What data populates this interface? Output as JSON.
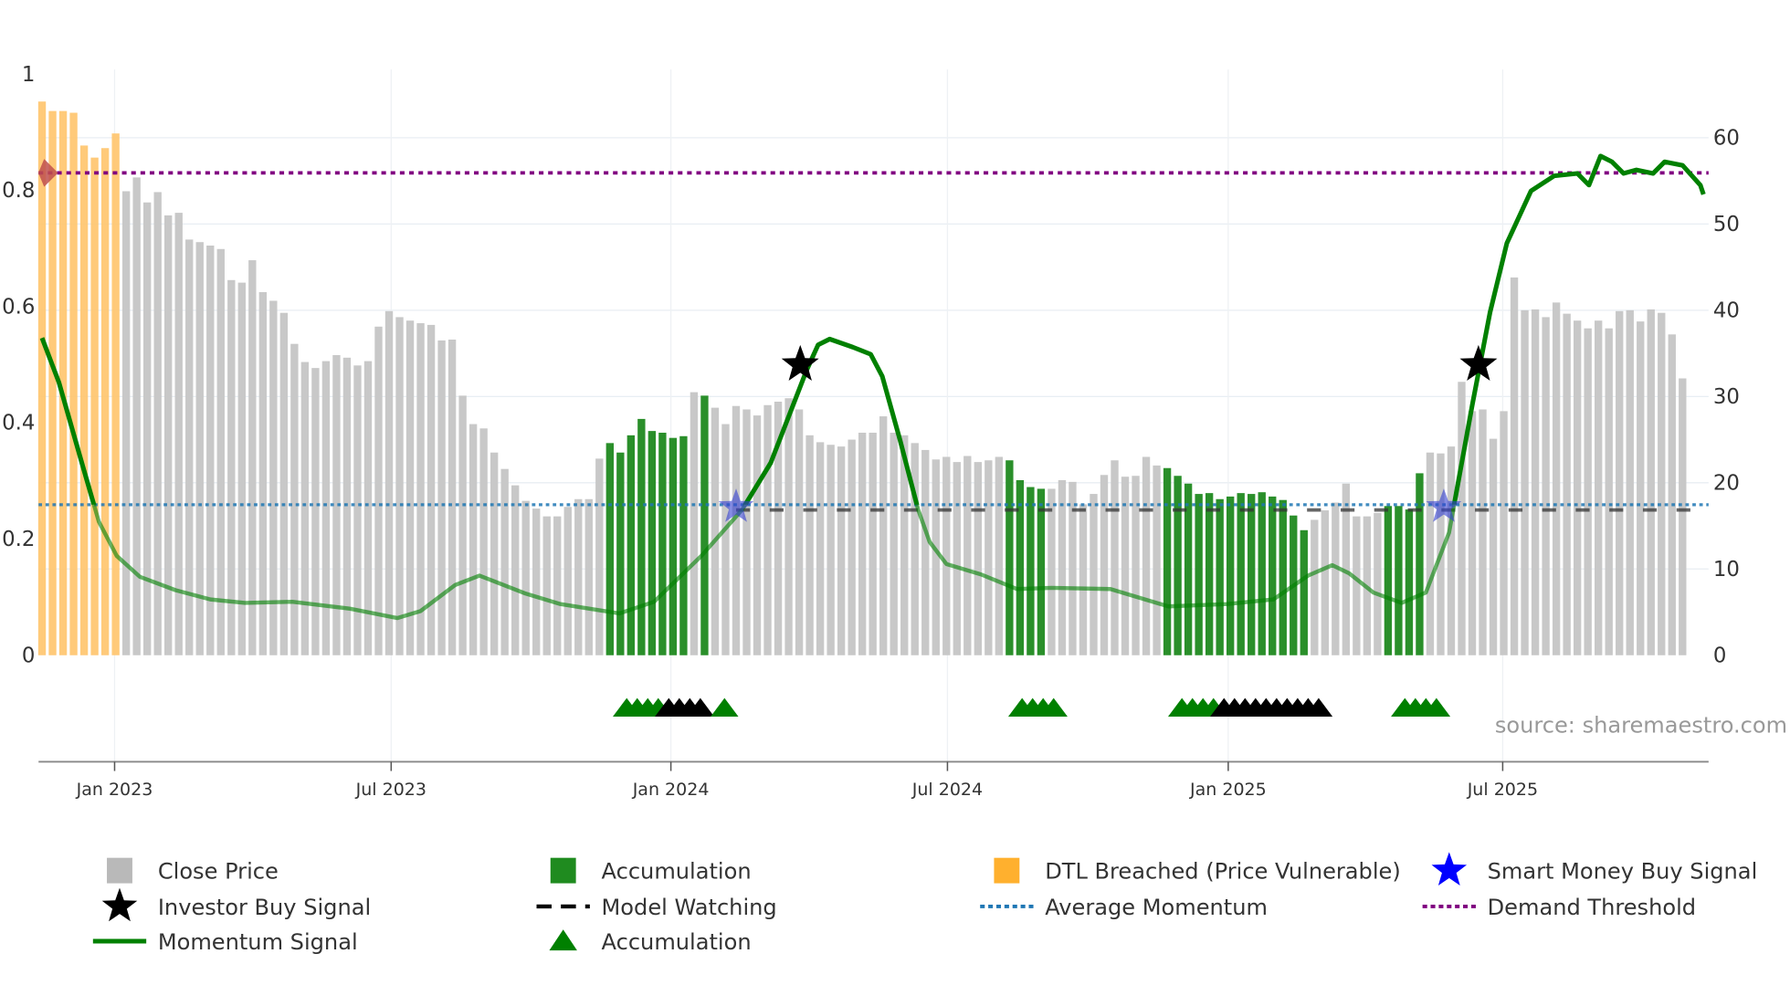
{
  "chart_data": {
    "type": "bar",
    "title": "",
    "source": "source: sharemaestro.com",
    "left_axis": {
      "ylim": [
        0,
        1
      ],
      "ticks": [
        "0",
        "0.2",
        "0.4",
        "0.6",
        "0.8",
        "1"
      ],
      "values": [
        0,
        0.2,
        0.4,
        0.6,
        0.8,
        1
      ]
    },
    "right_axis": {
      "ylim": [
        0,
        60
      ],
      "ticks": [
        "0",
        "10",
        "20",
        "30",
        "40",
        "50",
        "60"
      ],
      "values": [
        0,
        10,
        20,
        30,
        40,
        50,
        60
      ]
    },
    "x_ticks": [
      {
        "label": "Jan 2023",
        "week": 6.9
      },
      {
        "label": "Jul 2023",
        "week": 33.2
      },
      {
        "label": "Jan 2024",
        "week": 59.8
      },
      {
        "label": "Jul 2024",
        "week": 86.1
      },
      {
        "label": "Jan 2025",
        "week": 112.8
      },
      {
        "label": "Jul 2025",
        "week": 138.9
      }
    ],
    "close_price": [
      64.2,
      63.1,
      63.1,
      62.9,
      59.1,
      57.7,
      58.8,
      60.5,
      53.8,
      55.4,
      52.5,
      53.7,
      51.0,
      51.3,
      48.2,
      47.9,
      47.5,
      47.1,
      43.5,
      43.2,
      45.8,
      42.1,
      41.1,
      39.7,
      36.1,
      34.0,
      33.3,
      34.1,
      34.8,
      34.5,
      33.6,
      34.1,
      38.1,
      39.9,
      39.2,
      38.8,
      38.5,
      38.3,
      36.5,
      36.6,
      30.1,
      26.8,
      26.3,
      23.5,
      21.6,
      19.7,
      17.9,
      17.0,
      16.1,
      16.1,
      17.2,
      18.1,
      18.1,
      22.8,
      24.6,
      23.5,
      25.5,
      27.4,
      26.0,
      25.8,
      25.2,
      25.4,
      30.5,
      30.1,
      28.7,
      26.8,
      28.9,
      28.5,
      27.8,
      29.0,
      29.4,
      29.8,
      28.5,
      25.5,
      24.7,
      24.4,
      24.2,
      25.0,
      25.8,
      25.8,
      27.7,
      25.8,
      25.5,
      24.6,
      23.8,
      22.7,
      23.0,
      22.4,
      23.1,
      22.4,
      22.6,
      23.0,
      22.6,
      20.3,
      19.5,
      19.3,
      19.3,
      20.3,
      20.1,
      17.5,
      18.7,
      20.9,
      22.6,
      20.7,
      20.8,
      23.0,
      22.0,
      21.7,
      20.8,
      19.9,
      18.7,
      18.8,
      18.1,
      18.4,
      18.8,
      18.7,
      18.9,
      18.4,
      18.0,
      16.2,
      14.5,
      15.7,
      16.8,
      17.7,
      19.9,
      16.1,
      16.1,
      16.5,
      17.3,
      17.3,
      16.9,
      21.1,
      23.5,
      23.4,
      24.2,
      31.7,
      28.3,
      28.5,
      25.1,
      28.3,
      43.8,
      40.0,
      40.1,
      39.2,
      40.9,
      39.6,
      38.8,
      37.9,
      38.8,
      37.9,
      39.9,
      40.0,
      38.7,
      40.1,
      39.7,
      37.2,
      32.1
    ],
    "bar_state_runs": [
      [
        "dtl",
        8
      ],
      [
        "close",
        46
      ],
      [
        "accumulation",
        8
      ],
      [
        "close",
        1
      ],
      [
        "accumulation",
        1
      ],
      [
        "close",
        28
      ],
      [
        "accumulation",
        4
      ],
      [
        "close",
        11
      ],
      [
        "accumulation",
        14
      ],
      [
        "close",
        7
      ],
      [
        "accumulation",
        4
      ],
      [
        "close",
        25
      ]
    ],
    "momentum_signal": [
      [
        0,
        0.546
      ],
      [
        1.6,
        0.47
      ],
      [
        3.8,
        0.33
      ],
      [
        5.4,
        0.23
      ],
      [
        7.1,
        0.171
      ],
      [
        9.3,
        0.135
      ],
      [
        12.7,
        0.112
      ],
      [
        16,
        0.096
      ],
      [
        19.3,
        0.09
      ],
      [
        23.8,
        0.092
      ],
      [
        29.3,
        0.08
      ],
      [
        33.8,
        0.064
      ],
      [
        36,
        0.076
      ],
      [
        39.3,
        0.121
      ],
      [
        41.6,
        0.137
      ],
      [
        46,
        0.106
      ],
      [
        49.3,
        0.088
      ],
      [
        54.9,
        0.072
      ],
      [
        58.2,
        0.092
      ],
      [
        62.7,
        0.171
      ],
      [
        66.6,
        0.251
      ],
      [
        69.3,
        0.331
      ],
      [
        72.7,
        0.49
      ],
      [
        73.8,
        0.534
      ],
      [
        74.9,
        0.544
      ],
      [
        77.1,
        0.53
      ],
      [
        78.8,
        0.518
      ],
      [
        79.9,
        0.48
      ],
      [
        81.6,
        0.37
      ],
      [
        83.3,
        0.251
      ],
      [
        84.4,
        0.195
      ],
      [
        86,
        0.157
      ],
      [
        89.3,
        0.139
      ],
      [
        92.7,
        0.114
      ],
      [
        96,
        0.116
      ],
      [
        101.6,
        0.114
      ],
      [
        103.8,
        0.102
      ],
      [
        107.1,
        0.084
      ],
      [
        112.7,
        0.088
      ],
      [
        117.1,
        0.096
      ],
      [
        120.4,
        0.137
      ],
      [
        122.7,
        0.155
      ],
      [
        124.3,
        0.141
      ],
      [
        126.6,
        0.108
      ],
      [
        129.3,
        0.09
      ],
      [
        131.6,
        0.108
      ],
      [
        133.8,
        0.211
      ],
      [
        136,
        0.43
      ],
      [
        137.7,
        0.59
      ],
      [
        139.3,
        0.709
      ],
      [
        141.6,
        0.799
      ],
      [
        143.8,
        0.825
      ],
      [
        146,
        0.829
      ],
      [
        147.1,
        0.809
      ],
      [
        148.2,
        0.859
      ],
      [
        149.3,
        0.849
      ],
      [
        150.4,
        0.829
      ],
      [
        151.6,
        0.835
      ],
      [
        153.2,
        0.829
      ],
      [
        154.3,
        0.849
      ],
      [
        156,
        0.843
      ],
      [
        157.7,
        0.809
      ],
      [
        158,
        0.793
      ]
    ],
    "average_momentum": 0.259,
    "demand_threshold": 0.83,
    "model_watching": {
      "level": 0.25,
      "from_week": 66,
      "to_week": 158
    },
    "investor_buy_signals": [
      [
        72.1,
        0.5
      ],
      [
        136.6,
        0.5
      ]
    ],
    "smart_money_buy_signals": [
      [
        66.0,
        0.255
      ],
      [
        133.3,
        0.255
      ]
    ],
    "dtl_marker": [
      0.2,
      0.83
    ],
    "accumulation_markers": [
      {
        "week": 55.6,
        "color": "green"
      },
      {
        "week": 56.6,
        "color": "green"
      },
      {
        "week": 57.6,
        "color": "green"
      },
      {
        "week": 58.6,
        "color": "green"
      },
      {
        "week": 59.6,
        "color": "black"
      },
      {
        "week": 60.6,
        "color": "black"
      },
      {
        "week": 61.6,
        "color": "black"
      },
      {
        "week": 62.6,
        "color": "black"
      },
      {
        "week": 64.9,
        "color": "green"
      },
      {
        "week": 93.2,
        "color": "green"
      },
      {
        "week": 94.2,
        "color": "green"
      },
      {
        "week": 95.2,
        "color": "green"
      },
      {
        "week": 96.2,
        "color": "green"
      },
      {
        "week": 108.4,
        "color": "green"
      },
      {
        "week": 109.4,
        "color": "green"
      },
      {
        "week": 110.4,
        "color": "green"
      },
      {
        "week": 111.4,
        "color": "green"
      },
      {
        "week": 112.4,
        "color": "black"
      },
      {
        "week": 113.4,
        "color": "black"
      },
      {
        "week": 114.4,
        "color": "black"
      },
      {
        "week": 115.4,
        "color": "black"
      },
      {
        "week": 116.4,
        "color": "black"
      },
      {
        "week": 117.4,
        "color": "black"
      },
      {
        "week": 118.4,
        "color": "black"
      },
      {
        "week": 119.4,
        "color": "black"
      },
      {
        "week": 120.4,
        "color": "black"
      },
      {
        "week": 121.4,
        "color": "black"
      },
      {
        "week": 129.6,
        "color": "green"
      },
      {
        "week": 130.6,
        "color": "green"
      },
      {
        "week": 131.6,
        "color": "green"
      },
      {
        "week": 132.6,
        "color": "green"
      }
    ],
    "legend": [
      {
        "label": "Close Price",
        "kind": "square",
        "color": "#b9b9b9"
      },
      {
        "label": "Accumulation",
        "kind": "square",
        "color": "#1f8b1f"
      },
      {
        "label": "DTL Breached (Price Vulnerable)",
        "kind": "square",
        "color": "#ffb02e"
      },
      {
        "label": "Smart Money Buy Signal",
        "kind": "star",
        "color": "#0000ff"
      },
      {
        "label": "Investor Buy Signal",
        "kind": "star",
        "color": "#000000"
      },
      {
        "label": "Model Watching",
        "kind": "dash",
        "color": "#000000"
      },
      {
        "label": "Average Momentum",
        "kind": "dot",
        "color": "#1f77b4"
      },
      {
        "label": "Demand Threshold",
        "kind": "dot",
        "color": "#800080"
      },
      {
        "label": "Momentum Signal",
        "kind": "line",
        "color": "#008000"
      },
      {
        "label": "Accumulation",
        "kind": "triangle",
        "color": "#008000"
      }
    ],
    "colors": {
      "close": "#c8c8c8",
      "accumulation": "#2a8f2a",
      "dtl": "#ffc46b",
      "momentum": "#008000",
      "avg": "#1f77b4",
      "threshold": "#800080",
      "watch": "#333333",
      "smart": "#3340d0",
      "investor": "#000000",
      "dtl_marker": "#c0504d"
    }
  }
}
